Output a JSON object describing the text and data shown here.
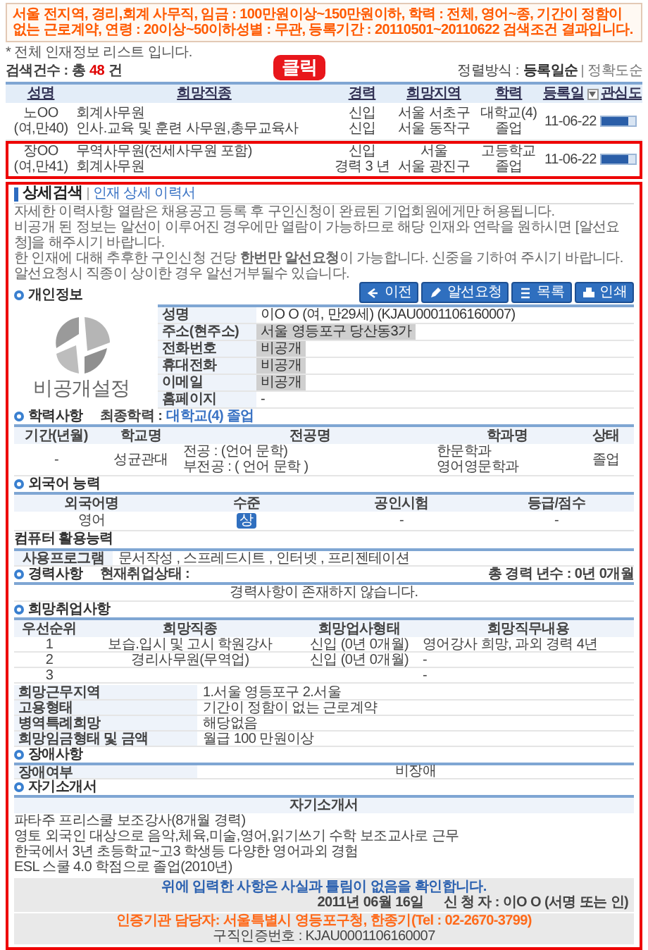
{
  "search_summary": "서울 전지역, 경리,회계 사무직, 임금 : 100만원이상~150만원이하, 학력 : 전체, 영어~종, 기간이 정함이 없는 근로계약, 연령 : 20이상~50이하성별 : 무관, 등록기간 : 20110501~20110622 검색조건 결과입니다.",
  "notice": "* 전체 인재정보 리스트 입니다.",
  "count": {
    "label": "검색건수 : 총",
    "value": "48",
    "unit": "건"
  },
  "sort": {
    "label": "정렬방식 :",
    "options": [
      {
        "label": "등록일순",
        "selected": true
      },
      {
        "label": "정확도순",
        "selected": false
      }
    ]
  },
  "list": {
    "columns": [
      "성명",
      "희망직종",
      "경력",
      "희망지역",
      "학력",
      "등록일",
      "관심도"
    ],
    "rows": [
      {
        "name": "노OO\n(여,만40)",
        "jobs": "회계사무원\n인사.교육 및 훈련 사무원,총무교육사",
        "career": "신입\n신입",
        "region": "서울 서초구\n서울 동작구",
        "education": "대학교(4)\n졸업",
        "date": "11-06-22",
        "level": 0.8,
        "selected": false
      },
      {
        "name": "장OO\n(여,만41)",
        "jobs": "무역사무원(전세사무원 포함)\n회계사무원",
        "career": "신입\n경력 3 년",
        "region": "서울\n서울 광진구",
        "education": "고등학교\n졸업",
        "date": "11-06-22",
        "level": 0.8,
        "selected": true
      }
    ]
  },
  "callout": "클릭",
  "detail": {
    "title": "상세검색",
    "subtitle": "인재 상세 이력서",
    "notices": [
      "자세한 이력사항 열람은 채용공고 등록 후 구인신청이 완료된 기업회원에게만 허용됩니다.",
      "비공개 된 정보는 알선이 이루어진 경우에만 열람이 가능하므로 해당 인재와 연락을 원하시면 [알선요청]을 해주시기 바랍니다.",
      "한 인재에 대해 추후한 구인신청 건당 **한번만 알선요청**이 가능합니다. 신중을 기하여 주시기 바랍니다.",
      "알선요청시 직종이 상이한 경우 알선거부될수 있습니다."
    ],
    "buttons": [
      "이전",
      "알선요청",
      "목록",
      "인쇄"
    ],
    "personal": {
      "heading": "개인정보",
      "photo_caption": "비공개설정",
      "fields": [
        {
          "label": "성명",
          "value": "이O O (여, 만29세) (KJAU0001106160007)",
          "boxed": false
        },
        {
          "label": "주소(현주소)",
          "value": "서울 영등포구 당산동3가",
          "boxed": true
        },
        {
          "label": "전화번호",
          "value": "비공개",
          "boxed": true
        },
        {
          "label": "휴대전화",
          "value": "비공개",
          "boxed": true
        },
        {
          "label": "이메일",
          "value": "비공개",
          "boxed": true
        },
        {
          "label": "홈페이지",
          "value": "-",
          "boxed": false
        }
      ]
    },
    "education": {
      "heading": "학력사항",
      "final_label": "최종학력 :",
      "final_value": "대학교(4) 졸업",
      "columns": [
        "기간(년월)",
        "학교명",
        "전공명",
        "학과명",
        "상태"
      ],
      "rows": [
        [
          "-",
          "성균관대",
          "전공 : (언어 문학)\n부전공 : ( 언어 문학 )",
          "한문학과\n영어영문학과",
          "졸업"
        ]
      ]
    },
    "languages": {
      "heading": "외국어 능력",
      "columns": [
        "외국어명",
        "수준",
        "공인시험",
        "등급/점수"
      ],
      "rows": [
        {
          "language": "영어",
          "level": "상",
          "test": "-",
          "score": "-"
        }
      ]
    },
    "computer": {
      "heading": "컴퓨터 활용능력",
      "label": "사용프로그램",
      "value": "문서작성 , 스프레드시트 , 인터넷 , 프리젠테이션"
    },
    "career": {
      "heading": "경력사항",
      "status_label": "현재취업상태 :",
      "total": "총 경력 년수 : 0년 0개월",
      "message": "경력사항이 존재하지 않습니다."
    },
    "desired": {
      "heading": "희망취업사항",
      "columns": [
        "우선순위",
        "희망직종",
        "희망업사형태",
        "희망직무내용"
      ],
      "rows": [
        [
          "1",
          "보습.입시 및 고시 학원강사",
          "신입 (0년 0개월)",
          "영어강사 희망, 과외 경력 4년"
        ],
        [
          "2",
          "경리사무원(무역업)",
          "신입 (0년 0개월)",
          "-"
        ],
        [
          "3",
          "",
          "",
          "-"
        ]
      ],
      "details": [
        {
          "label": "희망근무지역",
          "value": "1.서울 영등포구 2.서울"
        },
        {
          "label": "고용형태",
          "value": "기간이 정함이 없는 근로계약"
        },
        {
          "label": "병역특례희망",
          "value": "해당없음"
        },
        {
          "label": "희망임금형태 및 금액",
          "value": "월급 100 만원이상"
        }
      ]
    },
    "disability": {
      "heading": "장애사항",
      "label": "장애여부",
      "value": "비장애"
    },
    "intro": {
      "heading": "자기소개서",
      "header": "자기소개서",
      "paragraphs": [
        "파타주 프리스쿨 보조강사(8개월 경력)\n영토 외국인 대상으로 음악,체육,미술,영어,읽기쓰기 수학 보조교사로 근무",
        "한국에서 3년 초등학교~고3 학생등 다양한 영어과외 경험",
        "ESL 스쿨 4.0 학점으로 졸업(2010년)"
      ]
    },
    "confirm": {
      "statement": "위에 입력한 사항은 사실과 틀림이 없음을 확인합니다.",
      "date": "2011년 06월 16일",
      "signer": "신 청 자 : 이O O (서명 또는 인)"
    },
    "footer": {
      "contact": "인증기관 담당자: 서울특별시 영등포구청, 한종기(Tel : 02-2670-3799)",
      "cert": "구직인증번호 : KJAU0001106160007"
    }
  }
}
